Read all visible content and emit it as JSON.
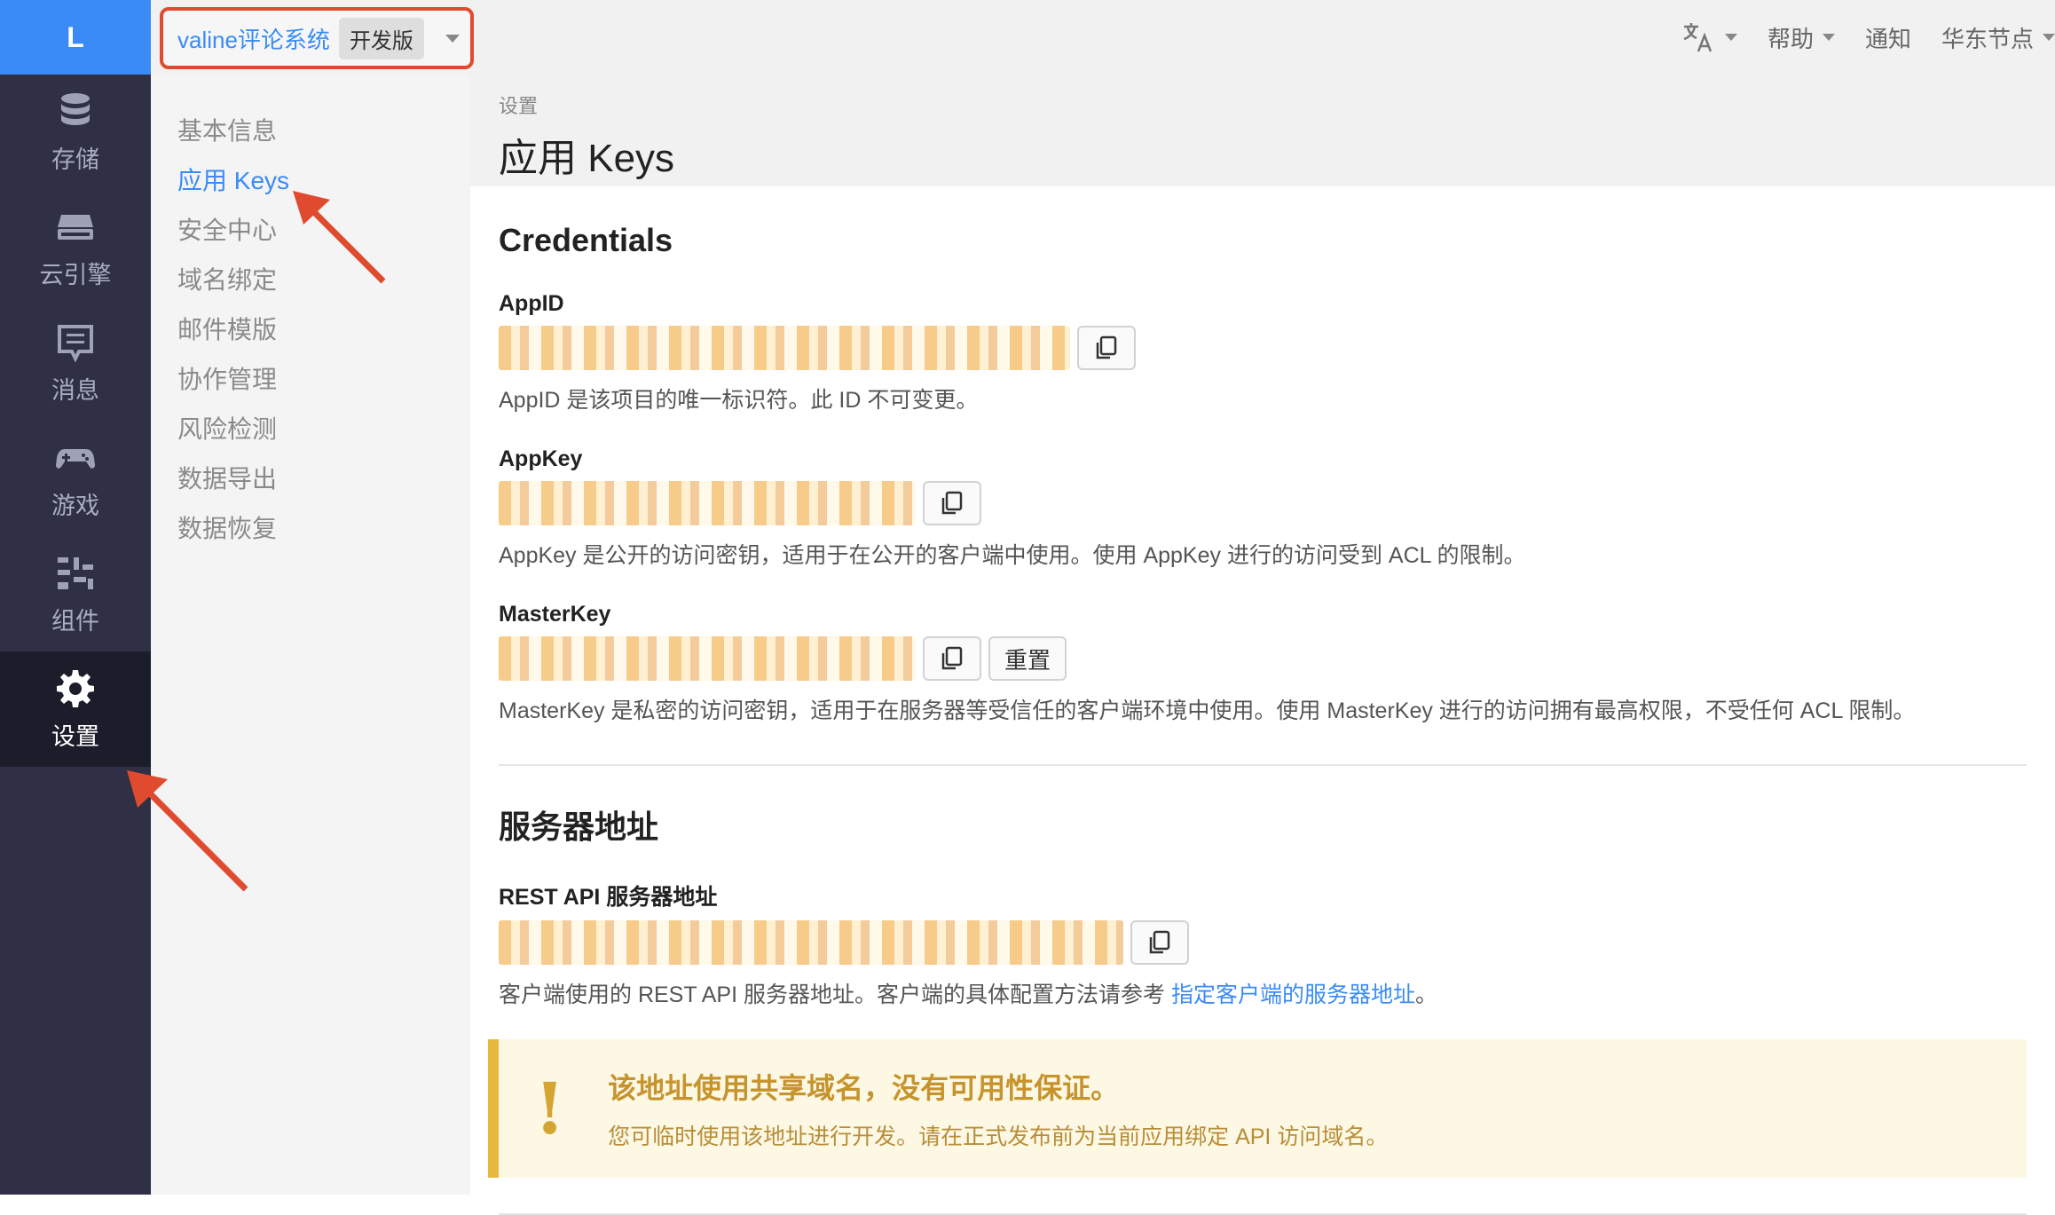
{
  "rail": {
    "logo": "L",
    "items": [
      {
        "label": "存储"
      },
      {
        "label": "云引擎"
      },
      {
        "label": "消息"
      },
      {
        "label": "游戏"
      },
      {
        "label": "组件"
      },
      {
        "label": "设置"
      }
    ]
  },
  "topbar": {
    "app_name": "valine评论系统",
    "env_badge": "开发版",
    "help": "帮助",
    "notifications": "通知",
    "region": "华东节点"
  },
  "subnav": {
    "items": [
      {
        "label": "基本信息"
      },
      {
        "label": "应用 Keys"
      },
      {
        "label": "安全中心"
      },
      {
        "label": "域名绑定"
      },
      {
        "label": "邮件模版"
      },
      {
        "label": "协作管理"
      },
      {
        "label": "风险检测"
      },
      {
        "label": "数据导出"
      },
      {
        "label": "数据恢复"
      }
    ]
  },
  "page": {
    "breadcrumb": "设置",
    "title": "应用 Keys"
  },
  "credentials": {
    "title": "Credentials",
    "appid_label": "AppID",
    "appid_help": "AppID 是该项目的唯一标识符。此 ID 不可变更。",
    "appkey_label": "AppKey",
    "appkey_help": "AppKey 是公开的访问密钥，适用于在公开的客户端中使用。使用 AppKey 进行的访问受到 ACL 的限制。",
    "masterkey_label": "MasterKey",
    "reset_label": "重置",
    "masterkey_help": "MasterKey 是私密的访问密钥，适用于在服务器等受信任的客户端环境中使用。使用 MasterKey 进行的访问拥有最高权限，不受任何 ACL 限制。"
  },
  "server": {
    "title": "服务器地址",
    "rest_label": "REST API 服务器地址",
    "help_prefix": "客户端使用的 REST API 服务器地址。客户端的具体配置方法请参考",
    "help_link": "指定客户端的服务器地址",
    "help_suffix": "。",
    "alert_title": "该地址使用共享域名，没有可用性保证。",
    "alert_body": "您可临时使用该地址进行开发。请在正式发布前为当前应用绑定 API 访问域名。"
  },
  "colors": {
    "accent": "#3a8bf5",
    "rail_bg": "#2f3045",
    "alert_border": "#e8b93e",
    "highlight_red": "#e04b2f"
  }
}
